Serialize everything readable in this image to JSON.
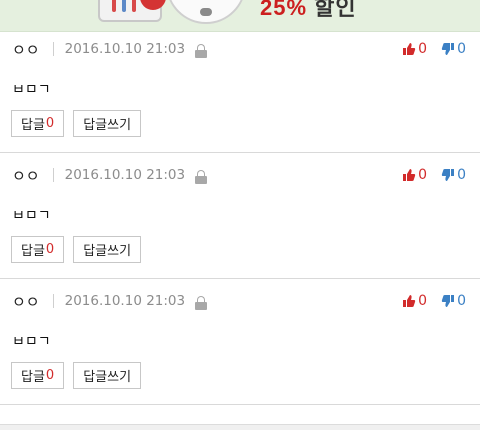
{
  "banner": {
    "headline": "25%",
    "headline_suffix": "할인"
  },
  "comments": [
    {
      "author": "ㅇㅇ",
      "date": "2016.10.10 21:03",
      "content": "ㅂㅁㄱ",
      "likes": "0",
      "dislikes": "0",
      "reply_label": "답글",
      "reply_count": "0",
      "write_reply_label": "답글쓰기"
    },
    {
      "author": "ㅇㅇ",
      "date": "2016.10.10 21:03",
      "content": "ㅂㅁㄱ",
      "likes": "0",
      "dislikes": "0",
      "reply_label": "답글",
      "reply_count": "0",
      "write_reply_label": "답글쓰기"
    },
    {
      "author": "ㅇㅇ",
      "date": "2016.10.10 21:03",
      "content": "ㅂㅁㄱ",
      "likes": "0",
      "dislikes": "0",
      "reply_label": "답글",
      "reply_count": "0",
      "write_reply_label": "답글쓰기"
    }
  ],
  "colors": {
    "like": "#d22b2b",
    "dislike": "#3b80c4",
    "reply_count": "#d22b2b",
    "date": "#8c8c8c",
    "banner_bg": "#e5f0df"
  },
  "icons": {
    "like": "thumbs-up-icon",
    "dislike": "thumbs-down-icon",
    "lock": "lock-icon"
  }
}
